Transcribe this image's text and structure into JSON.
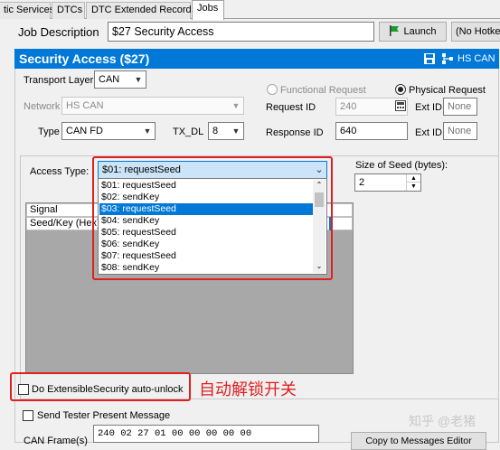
{
  "tabs": [
    {
      "label": "tic Services"
    },
    {
      "label": "DTCs"
    },
    {
      "label": "DTC Extended Records"
    },
    {
      "label": "Jobs"
    }
  ],
  "job": {
    "description_label": "Job Description",
    "description_value": "$27 Security Access",
    "launch_label": "Launch",
    "hotkey_label": "(No Hotkey"
  },
  "header": {
    "title": "Security Access ($27)",
    "badge": "HS CAN"
  },
  "settings": {
    "transport_layer_label": "Transport Layer",
    "transport_layer_value": "CAN",
    "network_label": "Network",
    "network_value": "HS CAN",
    "type_label": "Type",
    "type_value": "CAN FD",
    "txdl_label": "TX_DL",
    "txdl_value": "8",
    "functional_request_label": "Functional Request",
    "physical_request_label": "Physical Request",
    "request_id_label": "Request ID",
    "request_id_value": "240",
    "response_id_label": "Response ID",
    "response_id_value": "640",
    "ext_id_label": "Ext ID",
    "ext_id_placeholder": "None",
    "ext_id2_placeholder": "None"
  },
  "access": {
    "access_type_label": "Access Type:",
    "selected_value": "$01: requestSeed",
    "options": [
      "$01: requestSeed",
      "$02: sendKey",
      "$03: requestSeed",
      "$04: sendKey",
      "$05: requestSeed",
      "$06: sendKey",
      "$07: requestSeed",
      "$08: sendKey"
    ],
    "highlighted_index": 2,
    "size_of_seed_label": "Size of Seed (bytes):",
    "size_of_seed_value": "2"
  },
  "grid": {
    "header_signal": "Signal",
    "row_seed_key": "Seed/Key (Hex)"
  },
  "extensible": {
    "checkbox_label": "Do ExtensibleSecurity auto-unlock",
    "annotation": "自动解锁开关"
  },
  "tester": {
    "checkbox_label": "Send Tester Present Message",
    "can_frames_label": "CAN Frame(s)",
    "frame_value": "240  02 27 01 00 00 00 00 00",
    "copy_button_label": "Copy to Messages Editor"
  },
  "watermark": "知乎 @老猪",
  "colors": {
    "accent": "#0078d7",
    "annotation_red": "#e02020",
    "launch_flag": "#1c9a2a"
  }
}
